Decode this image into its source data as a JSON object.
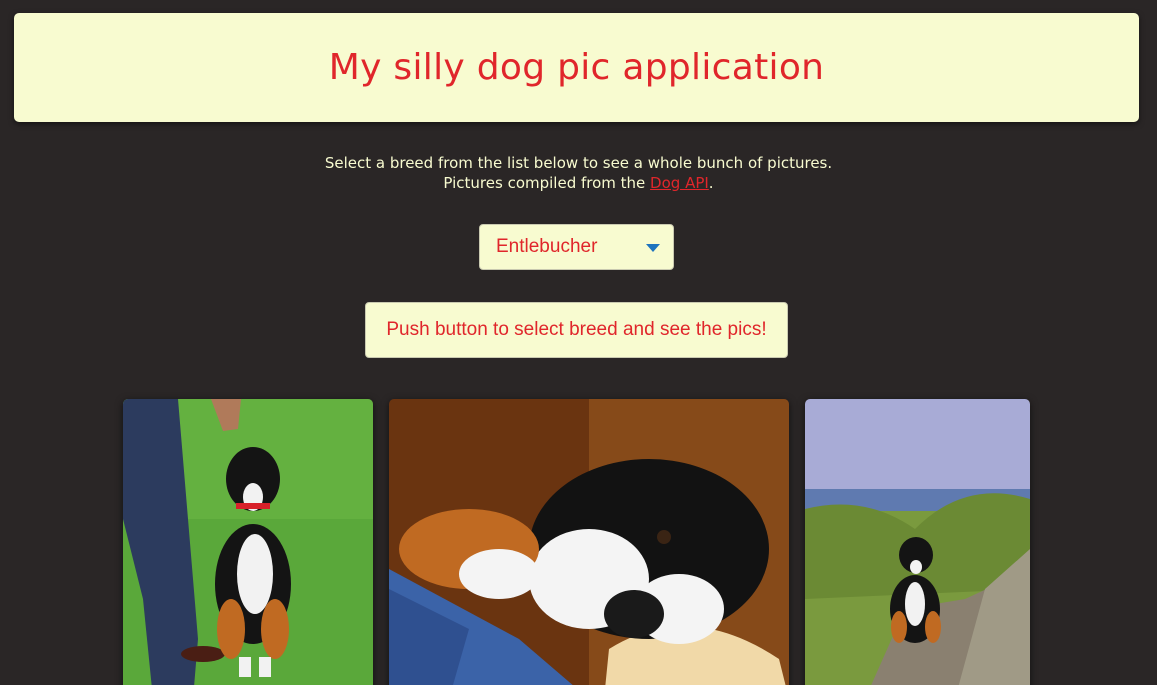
{
  "header": {
    "title": "My silly dog pic application"
  },
  "intro": {
    "line1": "Select a breed from the list below to see a whole bunch of pictures.",
    "line2_prefix": "Pictures compiled from the ",
    "link_text": "Dog API",
    "line2_suffix": "."
  },
  "breed_select": {
    "selected": "Entlebucher"
  },
  "action_button": {
    "label": "Push button to select breed and see the pics!"
  },
  "colors": {
    "accent": "#e0262b",
    "panel": "#f8fbd0",
    "background": "#2a2626"
  }
}
